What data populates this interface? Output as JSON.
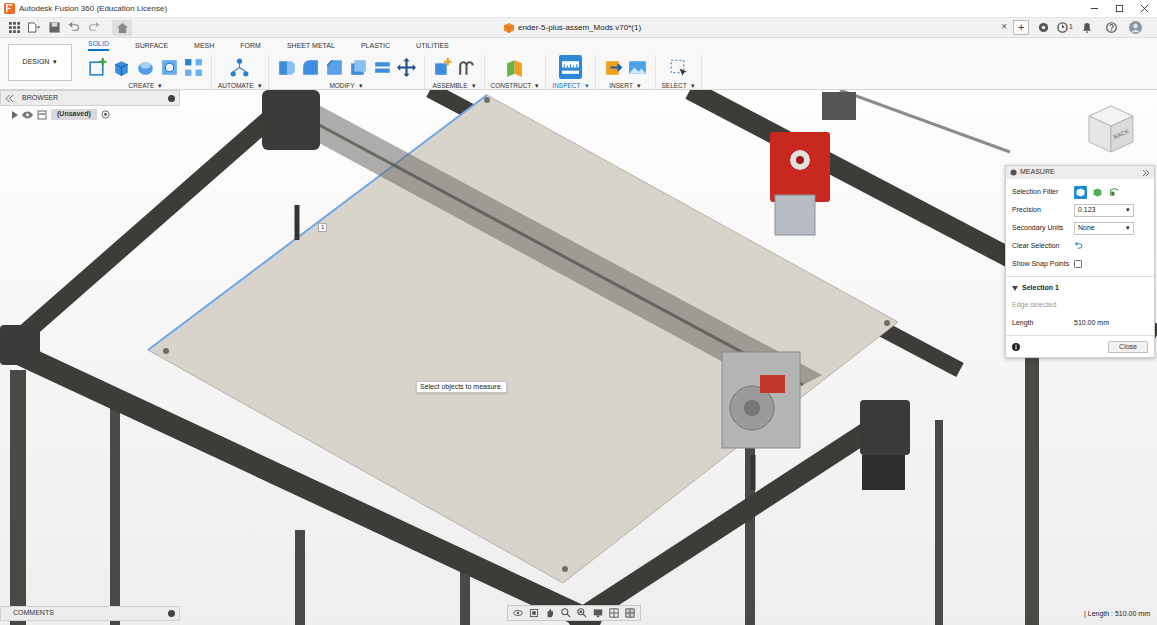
{
  "window": {
    "title": "Autodesk Fusion 360 (Education License)"
  },
  "document_tab": {
    "title": "ender-5-plus-assem_Mods v70*(1)",
    "close": "×"
  },
  "header": {
    "add": "+",
    "job_count": "1"
  },
  "workspace": {
    "label": "DESIGN",
    "caret": "▾"
  },
  "toolbar_tabs": [
    {
      "label": "SOLID",
      "selected": true
    },
    {
      "label": "SURFACE",
      "selected": false
    },
    {
      "label": "MESH",
      "selected": false
    },
    {
      "label": "FORM",
      "selected": false
    },
    {
      "label": "SHEET METAL",
      "selected": false
    },
    {
      "label": "PLASTIC",
      "selected": false
    },
    {
      "label": "UTILITIES",
      "selected": false
    }
  ],
  "tool_groups": [
    {
      "label": "CREATE",
      "caret": "▾",
      "active": false
    },
    {
      "label": "AUTOMATE",
      "caret": "▾",
      "active": false
    },
    {
      "label": "MODIFY",
      "caret": "▾",
      "active": false
    },
    {
      "label": "ASSEMBLE",
      "caret": "▾",
      "active": false
    },
    {
      "label": "CONSTRUCT",
      "caret": "▾",
      "active": false
    },
    {
      "label": "INSPECT",
      "caret": "▾",
      "active": true
    },
    {
      "label": "INSERT",
      "caret": "▾",
      "active": false
    },
    {
      "label": "SELECT",
      "caret": "▾",
      "active": false
    }
  ],
  "browser": {
    "title": "BROWSER",
    "root": {
      "label": "(Unsaved)",
      "expanded": false
    }
  },
  "viewport": {
    "tooltip": "Select objects to measure.",
    "marker": "1",
    "selected_edge": true
  },
  "viewcube": {
    "face": "BACK"
  },
  "measure": {
    "title": "MEASURE",
    "caret": "▾",
    "rows": [
      {
        "label": "Selection Filter",
        "kind": "filters"
      },
      {
        "label": "Precision",
        "kind": "select",
        "value": "0.123"
      },
      {
        "label": "Secondary Units",
        "kind": "select",
        "value": "None"
      },
      {
        "label": "Clear Selection",
        "kind": "action"
      },
      {
        "label": "Show Snap Points",
        "kind": "checkbox",
        "checked": false
      }
    ],
    "filters": [
      {
        "selected": true
      },
      {
        "selected": false
      },
      {
        "selected": false
      }
    ],
    "selection": {
      "title": "Selection 1",
      "expanded": true,
      "hint": "Edge selected",
      "label": "Length",
      "value": "510.00 mm"
    },
    "close": "Close"
  },
  "comments": {
    "title": "COMMENTS"
  },
  "status": {
    "reading": "| Length : 510.00 mm"
  }
}
